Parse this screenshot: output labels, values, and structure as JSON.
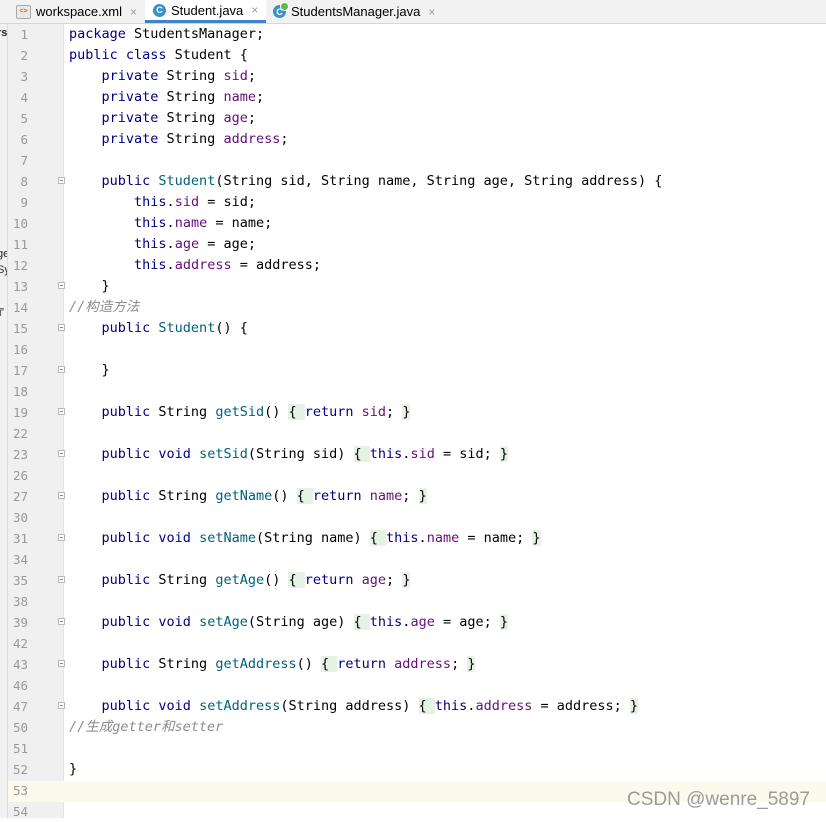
{
  "tabs": [
    {
      "label": "workspace.xml",
      "icon": "xml-file-icon",
      "active": false
    },
    {
      "label": "Student.java",
      "icon": "java-class-icon",
      "active": true
    },
    {
      "label": "StudentsManager.java",
      "icon": "java-class-runnable-icon",
      "active": false
    }
  ],
  "tab_close_glyph": "×",
  "left_strip_fragments": [
    "rs",
    "ge",
    "Sy",
    "₸"
  ],
  "current_line": 53,
  "watermark": "CSDN @wenre_5897",
  "colors": {
    "keyword": "#000080",
    "field": "#660e7a",
    "method": "#00627a",
    "comment": "#8c8c8c",
    "fold_highlight": "#e6f2e6",
    "active_tab_underline": "#4083c9"
  },
  "lines": [
    {
      "num": "1",
      "tokens": [
        {
          "t": "package",
          "c": "kw"
        },
        {
          "t": " StudentsManager;",
          "c": ""
        }
      ]
    },
    {
      "num": "2",
      "tokens": [
        {
          "t": "public class",
          "c": "kw"
        },
        {
          "t": " Student {",
          "c": ""
        }
      ]
    },
    {
      "num": "3",
      "tokens": [
        {
          "t": "    private",
          "c": "kw"
        },
        {
          "t": " String ",
          "c": ""
        },
        {
          "t": "sid",
          "c": "fld"
        },
        {
          "t": ";",
          "c": ""
        }
      ]
    },
    {
      "num": "4",
      "tokens": [
        {
          "t": "    private",
          "c": "kw"
        },
        {
          "t": " String ",
          "c": ""
        },
        {
          "t": "name",
          "c": "fld"
        },
        {
          "t": ";",
          "c": ""
        }
      ]
    },
    {
      "num": "5",
      "tokens": [
        {
          "t": "    private",
          "c": "kw"
        },
        {
          "t": " String ",
          "c": ""
        },
        {
          "t": "age",
          "c": "fld"
        },
        {
          "t": ";",
          "c": ""
        }
      ]
    },
    {
      "num": "6",
      "tokens": [
        {
          "t": "    private",
          "c": "kw"
        },
        {
          "t": " String ",
          "c": ""
        },
        {
          "t": "address",
          "c": "fld"
        },
        {
          "t": ";",
          "c": ""
        }
      ]
    },
    {
      "num": "7",
      "tokens": []
    },
    {
      "num": "8",
      "fold": true,
      "tokens": [
        {
          "t": "    public",
          "c": "kw"
        },
        {
          "t": " ",
          "c": ""
        },
        {
          "t": "Student",
          "c": "mth"
        },
        {
          "t": "(String sid, String name, String age, String address) {",
          "c": ""
        }
      ]
    },
    {
      "num": "9",
      "tokens": [
        {
          "t": "        this",
          "c": "kw"
        },
        {
          "t": ".",
          "c": ""
        },
        {
          "t": "sid",
          "c": "fld"
        },
        {
          "t": " = sid;",
          "c": ""
        }
      ]
    },
    {
      "num": "10",
      "tokens": [
        {
          "t": "        this",
          "c": "kw"
        },
        {
          "t": ".",
          "c": ""
        },
        {
          "t": "name",
          "c": "fld"
        },
        {
          "t": " = name;",
          "c": ""
        }
      ]
    },
    {
      "num": "11",
      "tokens": [
        {
          "t": "        this",
          "c": "kw"
        },
        {
          "t": ".",
          "c": ""
        },
        {
          "t": "age",
          "c": "fld"
        },
        {
          "t": " = age;",
          "c": ""
        }
      ]
    },
    {
      "num": "12",
      "tokens": [
        {
          "t": "        this",
          "c": "kw"
        },
        {
          "t": ".",
          "c": ""
        },
        {
          "t": "address",
          "c": "fld"
        },
        {
          "t": " = address;",
          "c": ""
        }
      ]
    },
    {
      "num": "13",
      "fold": true,
      "tokens": [
        {
          "t": "    }",
          "c": ""
        }
      ]
    },
    {
      "num": "14",
      "tokens": [
        {
          "t": "//构造方法",
          "c": "cmt"
        }
      ]
    },
    {
      "num": "15",
      "fold": true,
      "tokens": [
        {
          "t": "    public",
          "c": "kw"
        },
        {
          "t": " ",
          "c": ""
        },
        {
          "t": "Student",
          "c": "mth"
        },
        {
          "t": "() {",
          "c": ""
        }
      ]
    },
    {
      "num": "16",
      "tokens": []
    },
    {
      "num": "17",
      "fold": true,
      "tokens": [
        {
          "t": "    }",
          "c": ""
        }
      ]
    },
    {
      "num": "18",
      "tokens": []
    },
    {
      "num": "19",
      "fold": true,
      "tokens": [
        {
          "t": "    public",
          "c": "kw"
        },
        {
          "t": " String ",
          "c": ""
        },
        {
          "t": "getSid",
          "c": "mth"
        },
        {
          "t": "() ",
          "c": ""
        },
        {
          "t": "{ ",
          "c": "fd"
        },
        {
          "t": "return ",
          "c": "kw"
        },
        {
          "t": "sid",
          "c": "fld"
        },
        {
          "t": "; ",
          "c": ""
        },
        {
          "t": "}",
          "c": "fd"
        }
      ]
    },
    {
      "num": "22",
      "tokens": []
    },
    {
      "num": "23",
      "fold": true,
      "tokens": [
        {
          "t": "    public void",
          "c": "kw"
        },
        {
          "t": " ",
          "c": ""
        },
        {
          "t": "setSid",
          "c": "mth"
        },
        {
          "t": "(String sid) ",
          "c": ""
        },
        {
          "t": "{ ",
          "c": "fd"
        },
        {
          "t": "this",
          "c": "kw"
        },
        {
          "t": ".",
          "c": ""
        },
        {
          "t": "sid",
          "c": "fld"
        },
        {
          "t": " = sid; ",
          "c": ""
        },
        {
          "t": "}",
          "c": "fd"
        }
      ]
    },
    {
      "num": "26",
      "tokens": []
    },
    {
      "num": "27",
      "fold": true,
      "tokens": [
        {
          "t": "    public",
          "c": "kw"
        },
        {
          "t": " String ",
          "c": ""
        },
        {
          "t": "getName",
          "c": "mth"
        },
        {
          "t": "() ",
          "c": ""
        },
        {
          "t": "{ ",
          "c": "fd"
        },
        {
          "t": "return ",
          "c": "kw"
        },
        {
          "t": "name",
          "c": "fld"
        },
        {
          "t": "; ",
          "c": ""
        },
        {
          "t": "}",
          "c": "fd"
        }
      ]
    },
    {
      "num": "30",
      "tokens": []
    },
    {
      "num": "31",
      "fold": true,
      "tokens": [
        {
          "t": "    public void",
          "c": "kw"
        },
        {
          "t": " ",
          "c": ""
        },
        {
          "t": "setName",
          "c": "mth"
        },
        {
          "t": "(String name) ",
          "c": ""
        },
        {
          "t": "{ ",
          "c": "fd"
        },
        {
          "t": "this",
          "c": "kw"
        },
        {
          "t": ".",
          "c": ""
        },
        {
          "t": "name",
          "c": "fld"
        },
        {
          "t": " = name; ",
          "c": ""
        },
        {
          "t": "}",
          "c": "fd"
        }
      ]
    },
    {
      "num": "34",
      "tokens": []
    },
    {
      "num": "35",
      "fold": true,
      "tokens": [
        {
          "t": "    public",
          "c": "kw"
        },
        {
          "t": " String ",
          "c": ""
        },
        {
          "t": "getAge",
          "c": "mth"
        },
        {
          "t": "() ",
          "c": ""
        },
        {
          "t": "{ ",
          "c": "fd"
        },
        {
          "t": "return ",
          "c": "kw"
        },
        {
          "t": "age",
          "c": "fld"
        },
        {
          "t": "; ",
          "c": ""
        },
        {
          "t": "}",
          "c": "fd"
        }
      ]
    },
    {
      "num": "38",
      "tokens": []
    },
    {
      "num": "39",
      "fold": true,
      "tokens": [
        {
          "t": "    public void",
          "c": "kw"
        },
        {
          "t": " ",
          "c": ""
        },
        {
          "t": "setAge",
          "c": "mth"
        },
        {
          "t": "(String age) ",
          "c": ""
        },
        {
          "t": "{ ",
          "c": "fd"
        },
        {
          "t": "this",
          "c": "kw"
        },
        {
          "t": ".",
          "c": ""
        },
        {
          "t": "age",
          "c": "fld"
        },
        {
          "t": " = age; ",
          "c": ""
        },
        {
          "t": "}",
          "c": "fd"
        }
      ]
    },
    {
      "num": "42",
      "tokens": []
    },
    {
      "num": "43",
      "fold": true,
      "tokens": [
        {
          "t": "    public",
          "c": "kw"
        },
        {
          "t": " String ",
          "c": ""
        },
        {
          "t": "getAddress",
          "c": "mth"
        },
        {
          "t": "() ",
          "c": ""
        },
        {
          "t": "{ ",
          "c": "fd"
        },
        {
          "t": "return ",
          "c": "kw"
        },
        {
          "t": "address",
          "c": "fld"
        },
        {
          "t": "; ",
          "c": ""
        },
        {
          "t": "}",
          "c": "fd"
        }
      ]
    },
    {
      "num": "46",
      "tokens": []
    },
    {
      "num": "47",
      "fold": true,
      "tokens": [
        {
          "t": "    public void",
          "c": "kw"
        },
        {
          "t": " ",
          "c": ""
        },
        {
          "t": "setAddress",
          "c": "mth"
        },
        {
          "t": "(String address) ",
          "c": ""
        },
        {
          "t": "{ ",
          "c": "fd"
        },
        {
          "t": "this",
          "c": "kw"
        },
        {
          "t": ".",
          "c": ""
        },
        {
          "t": "address",
          "c": "fld"
        },
        {
          "t": " = address; ",
          "c": ""
        },
        {
          "t": "}",
          "c": "fd"
        }
      ]
    },
    {
      "num": "50",
      "tokens": [
        {
          "t": "//生成getter和setter",
          "c": "cmt"
        }
      ]
    },
    {
      "num": "51",
      "tokens": []
    },
    {
      "num": "52",
      "tokens": [
        {
          "t": "}",
          "c": ""
        }
      ]
    },
    {
      "num": "53",
      "tokens": []
    },
    {
      "num": "54",
      "tokens": []
    }
  ]
}
